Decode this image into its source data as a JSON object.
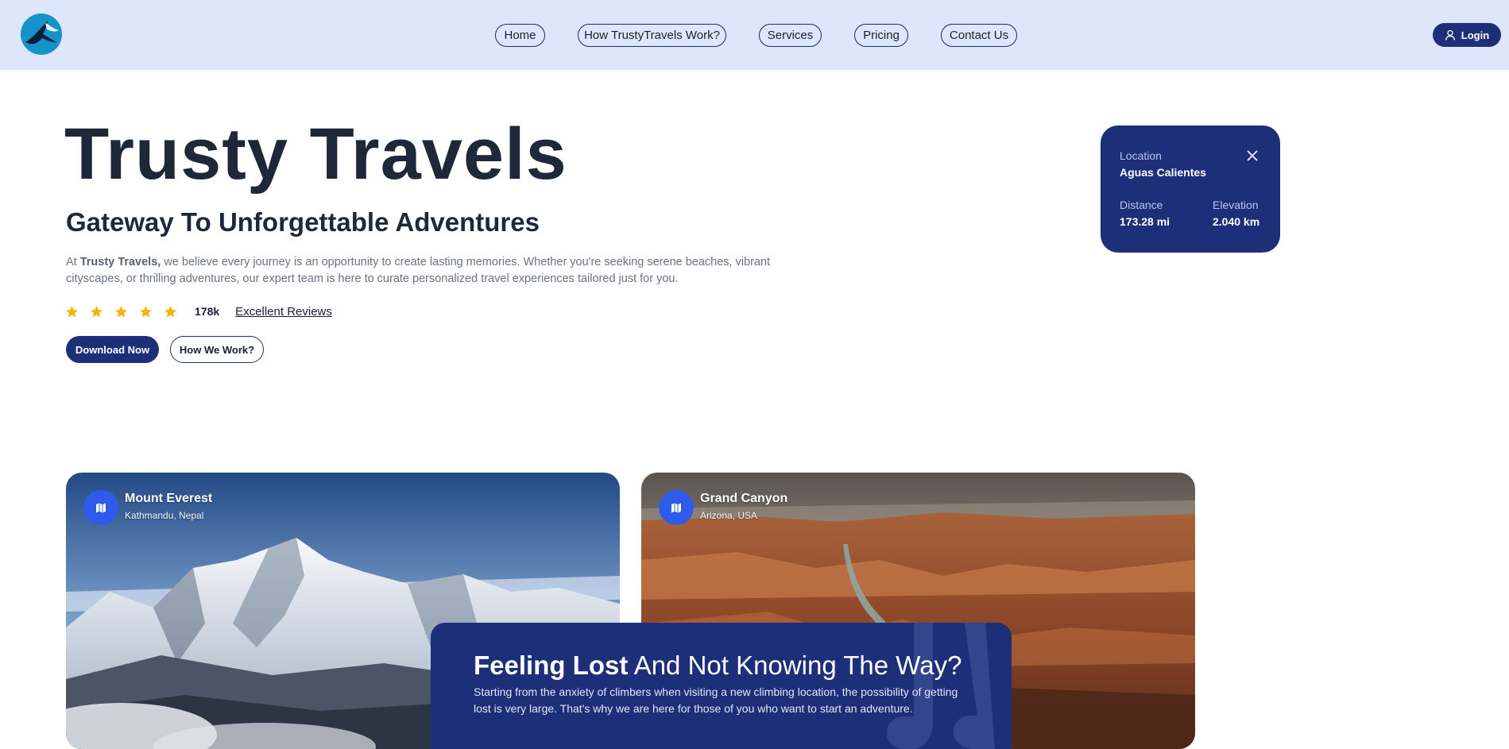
{
  "header": {
    "logo_icon": "swallow-bird-logo-icon",
    "nav": [
      {
        "label": "Home"
      },
      {
        "label": "How TrustyTravels Work?"
      },
      {
        "label": "Services"
      },
      {
        "label": "Pricing"
      },
      {
        "label": "Contact Us"
      }
    ],
    "login_label": "Login",
    "login_icon": "user-icon"
  },
  "hero": {
    "title": "Trusty Travels",
    "subtitle": "Gateway To Unforgettable Adventures",
    "desc_prefix": "At ",
    "desc_brand": "Trusty Travels,",
    "desc_rest": " we believe every journey is an opportunity to create lasting memories. Whether you're seeking serene beaches, vibrant cityscapes, or thrilling adventures, our expert team is here to curate personalized travel experiences tailored just for you.",
    "rating_stars": 5,
    "review_count": "178k",
    "review_link": "Excellent Reviews",
    "primary_button": "Download Now",
    "secondary_button": "How We Work?"
  },
  "location_card": {
    "location_label": "Location",
    "location_value": "Aguas Calientes",
    "distance_label": "Distance",
    "distance_value": "173.28 mi",
    "elevation_label": "Elevation",
    "elevation_value": "2.040 km",
    "close_icon": "close-icon"
  },
  "destinations": [
    {
      "name": "Mount Everest",
      "place": "Kathmandu, Nepal",
      "icon": "map-icon"
    },
    {
      "name": "Grand Canyon",
      "place": "Arizona, USA",
      "icon": "map-icon"
    }
  ],
  "lost_banner": {
    "title_bold": "Feeling Lost",
    "title_rest": " And Not Knowing The Way?",
    "desc": "Starting from the anxiety of climbers when visiting a new climbing location, the possibility of getting lost is very large. That's why we are here for those of you who want to start an adventure."
  },
  "colors": {
    "header_bg": "#dde6fb",
    "brand_navy": "#1e2f7a",
    "pin_blue": "#2f5bea",
    "star_gold": "#f5b400"
  }
}
